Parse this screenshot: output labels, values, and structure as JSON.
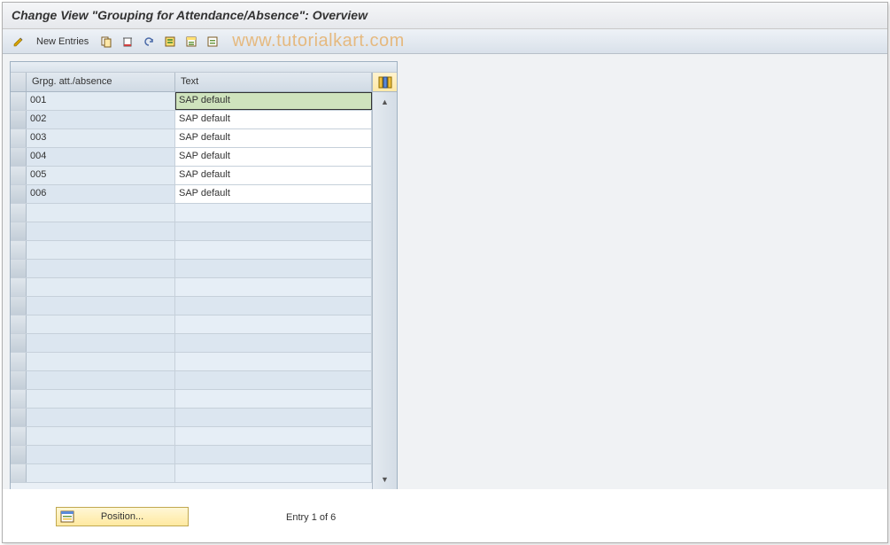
{
  "title": "Change View \"Grouping for Attendance/Absence\": Overview",
  "toolbar": {
    "new_entries_label": "New Entries"
  },
  "watermark": "www.tutorialkart.com",
  "table": {
    "columns": {
      "grp": "Grpg. att./absence",
      "text": "Text"
    },
    "rows": [
      {
        "grp": "001",
        "text": "SAP default",
        "selected": true
      },
      {
        "grp": "002",
        "text": "SAP default",
        "selected": false
      },
      {
        "grp": "003",
        "text": "SAP default",
        "selected": false
      },
      {
        "grp": "004",
        "text": "SAP default",
        "selected": false
      },
      {
        "grp": "005",
        "text": "SAP default",
        "selected": false
      },
      {
        "grp": "006",
        "text": "SAP default",
        "selected": false
      }
    ],
    "empty_row_count": 15
  },
  "footer": {
    "position_label": "Position...",
    "entry_status": "Entry 1 of 6"
  }
}
